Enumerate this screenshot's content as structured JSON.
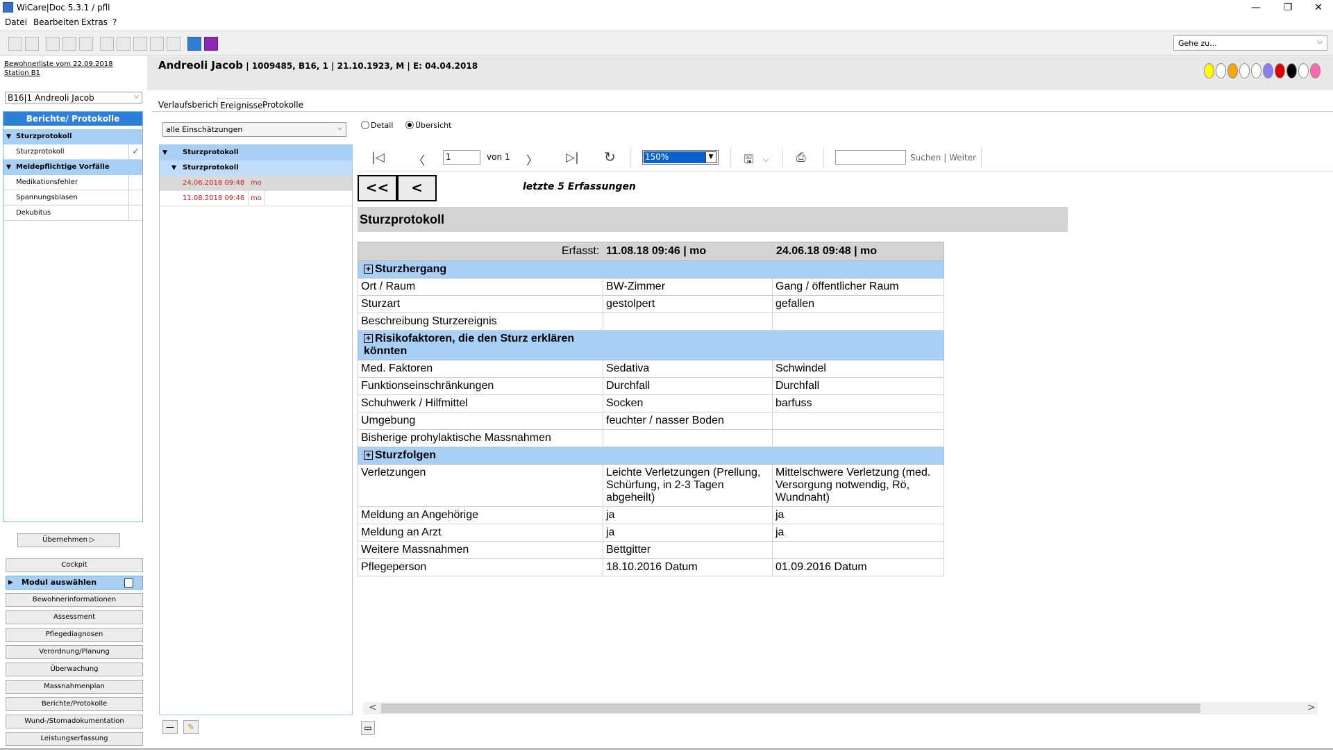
{
  "window": {
    "title": "WiCare|Doc 5.3.1  / pfll",
    "min": "—",
    "restore": "❐",
    "close": "✕"
  },
  "menu": [
    "Datei",
    "Bearbeiten",
    "Extras",
    "?"
  ],
  "goto": {
    "value": "Gehe zu..."
  },
  "left": {
    "list_link": "Bewohnerliste vom 22.09.2018",
    "station_link": "Station B1",
    "patient_select": "B16|1  Andreoli Jacob",
    "tree_header": "Berichte/ Protokolle",
    "tree": [
      {
        "label": "Sturzprotokoll",
        "type": "group"
      },
      {
        "label": "Sturzprotokoll",
        "type": "sub",
        "checked": true
      },
      {
        "label": "Meldepflichtige Vorfälle",
        "type": "group"
      },
      {
        "label": "Medikationsfehler",
        "type": "sub"
      },
      {
        "label": "Spannungsblasen",
        "type": "sub"
      },
      {
        "label": "Dekubitus",
        "type": "sub"
      }
    ],
    "uebernehmen": "Übernehmen",
    "cockpit": "Cockpit",
    "modul": "Modul auswählen",
    "nav": [
      "Bewohnerinformationen",
      "Assessment",
      "Pflegediagnosen",
      "Verordnung/Planung",
      "Überwachung",
      "Massnahmenplan",
      "Berichte/Protokolle",
      "Wund-/Stomadokumentation",
      "Leistungserfassung"
    ]
  },
  "header": {
    "name": "Andreoli Jacob",
    "meta": " | 1009485, B16, 1 | 21.10.1923, M | E: 04.04.2018",
    "dots": [
      "#ffff00",
      "#ffffff",
      "#ffa500",
      "#ffffff",
      "#ffffff",
      "#8c7cf0",
      "#e00000",
      "#000000",
      "#ffffff",
      "#ff69b4"
    ]
  },
  "tabs": [
    "Verlaufsbericht",
    "Ereignisse",
    "Protokolle"
  ],
  "filter": {
    "value": "alle Einschätzungen"
  },
  "radios": {
    "detail": "Detail",
    "uebersicht": "Übersicht"
  },
  "events": {
    "group1": "Sturzprotokoll",
    "group2": "Sturzprotokoll",
    "entries": [
      {
        "date": "24.06.2018 09:48",
        "user": "mo"
      },
      {
        "date": "11.08.2018 09:46",
        "user": "mo"
      }
    ]
  },
  "report_toolbar": {
    "page": "1",
    "von": "von 1",
    "zoom": "150%",
    "search_links": "Suchen | Weiter"
  },
  "report": {
    "btn_first": "<<",
    "btn_prev": "<",
    "last5": "letzte 5 Erfassungen",
    "title": "Sturzprotokoll",
    "erfasst_label": "Erfasst:",
    "col1": "11.08.18 09:46 | mo",
    "col2": "24.06.18 09:48 | mo",
    "sections": [
      {
        "title": "Sturzhergang",
        "rows": [
          [
            "Ort / Raum",
            "BW-Zimmer",
            "Gang / öffentlicher Raum"
          ],
          [
            "Sturzart",
            "gestolpert",
            "gefallen"
          ],
          [
            "Beschreibung Sturzereignis",
            "",
            ""
          ]
        ]
      },
      {
        "title": "Risikofaktoren, die den Sturz erklären könnten",
        "rows": [
          [
            "Med. Faktoren",
            "Sedativa",
            "Schwindel"
          ],
          [
            "Funktionseinschränkungen",
            "Durchfall",
            "Durchfall"
          ],
          [
            "Schuhwerk / Hilfmittel",
            "Socken",
            "barfuss"
          ],
          [
            "Umgebung",
            "feuchter / nasser Boden",
            ""
          ],
          [
            "Bisherige prohylaktische Massnahmen",
            "",
            ""
          ]
        ]
      },
      {
        "title": "Sturzfolgen",
        "rows": [
          [
            "Verletzungen",
            "Leichte Verletzungen (Prellung, Schürfung, in 2-3 Tagen abgeheilt)",
            "Mittelschwere Verletzung (med. Versorgung notwendig, Rö, Wundnaht)"
          ],
          [
            "Meldung an Angehörige",
            "ja",
            "ja"
          ],
          [
            "Meldung an Arzt",
            "ja",
            "ja"
          ],
          [
            "Weitere Massnahmen",
            "Bettgitter",
            ""
          ],
          [
            "Pflegeperson",
            "18.10.2016 Datum",
            "01.09.2016 Datum"
          ]
        ]
      }
    ]
  }
}
